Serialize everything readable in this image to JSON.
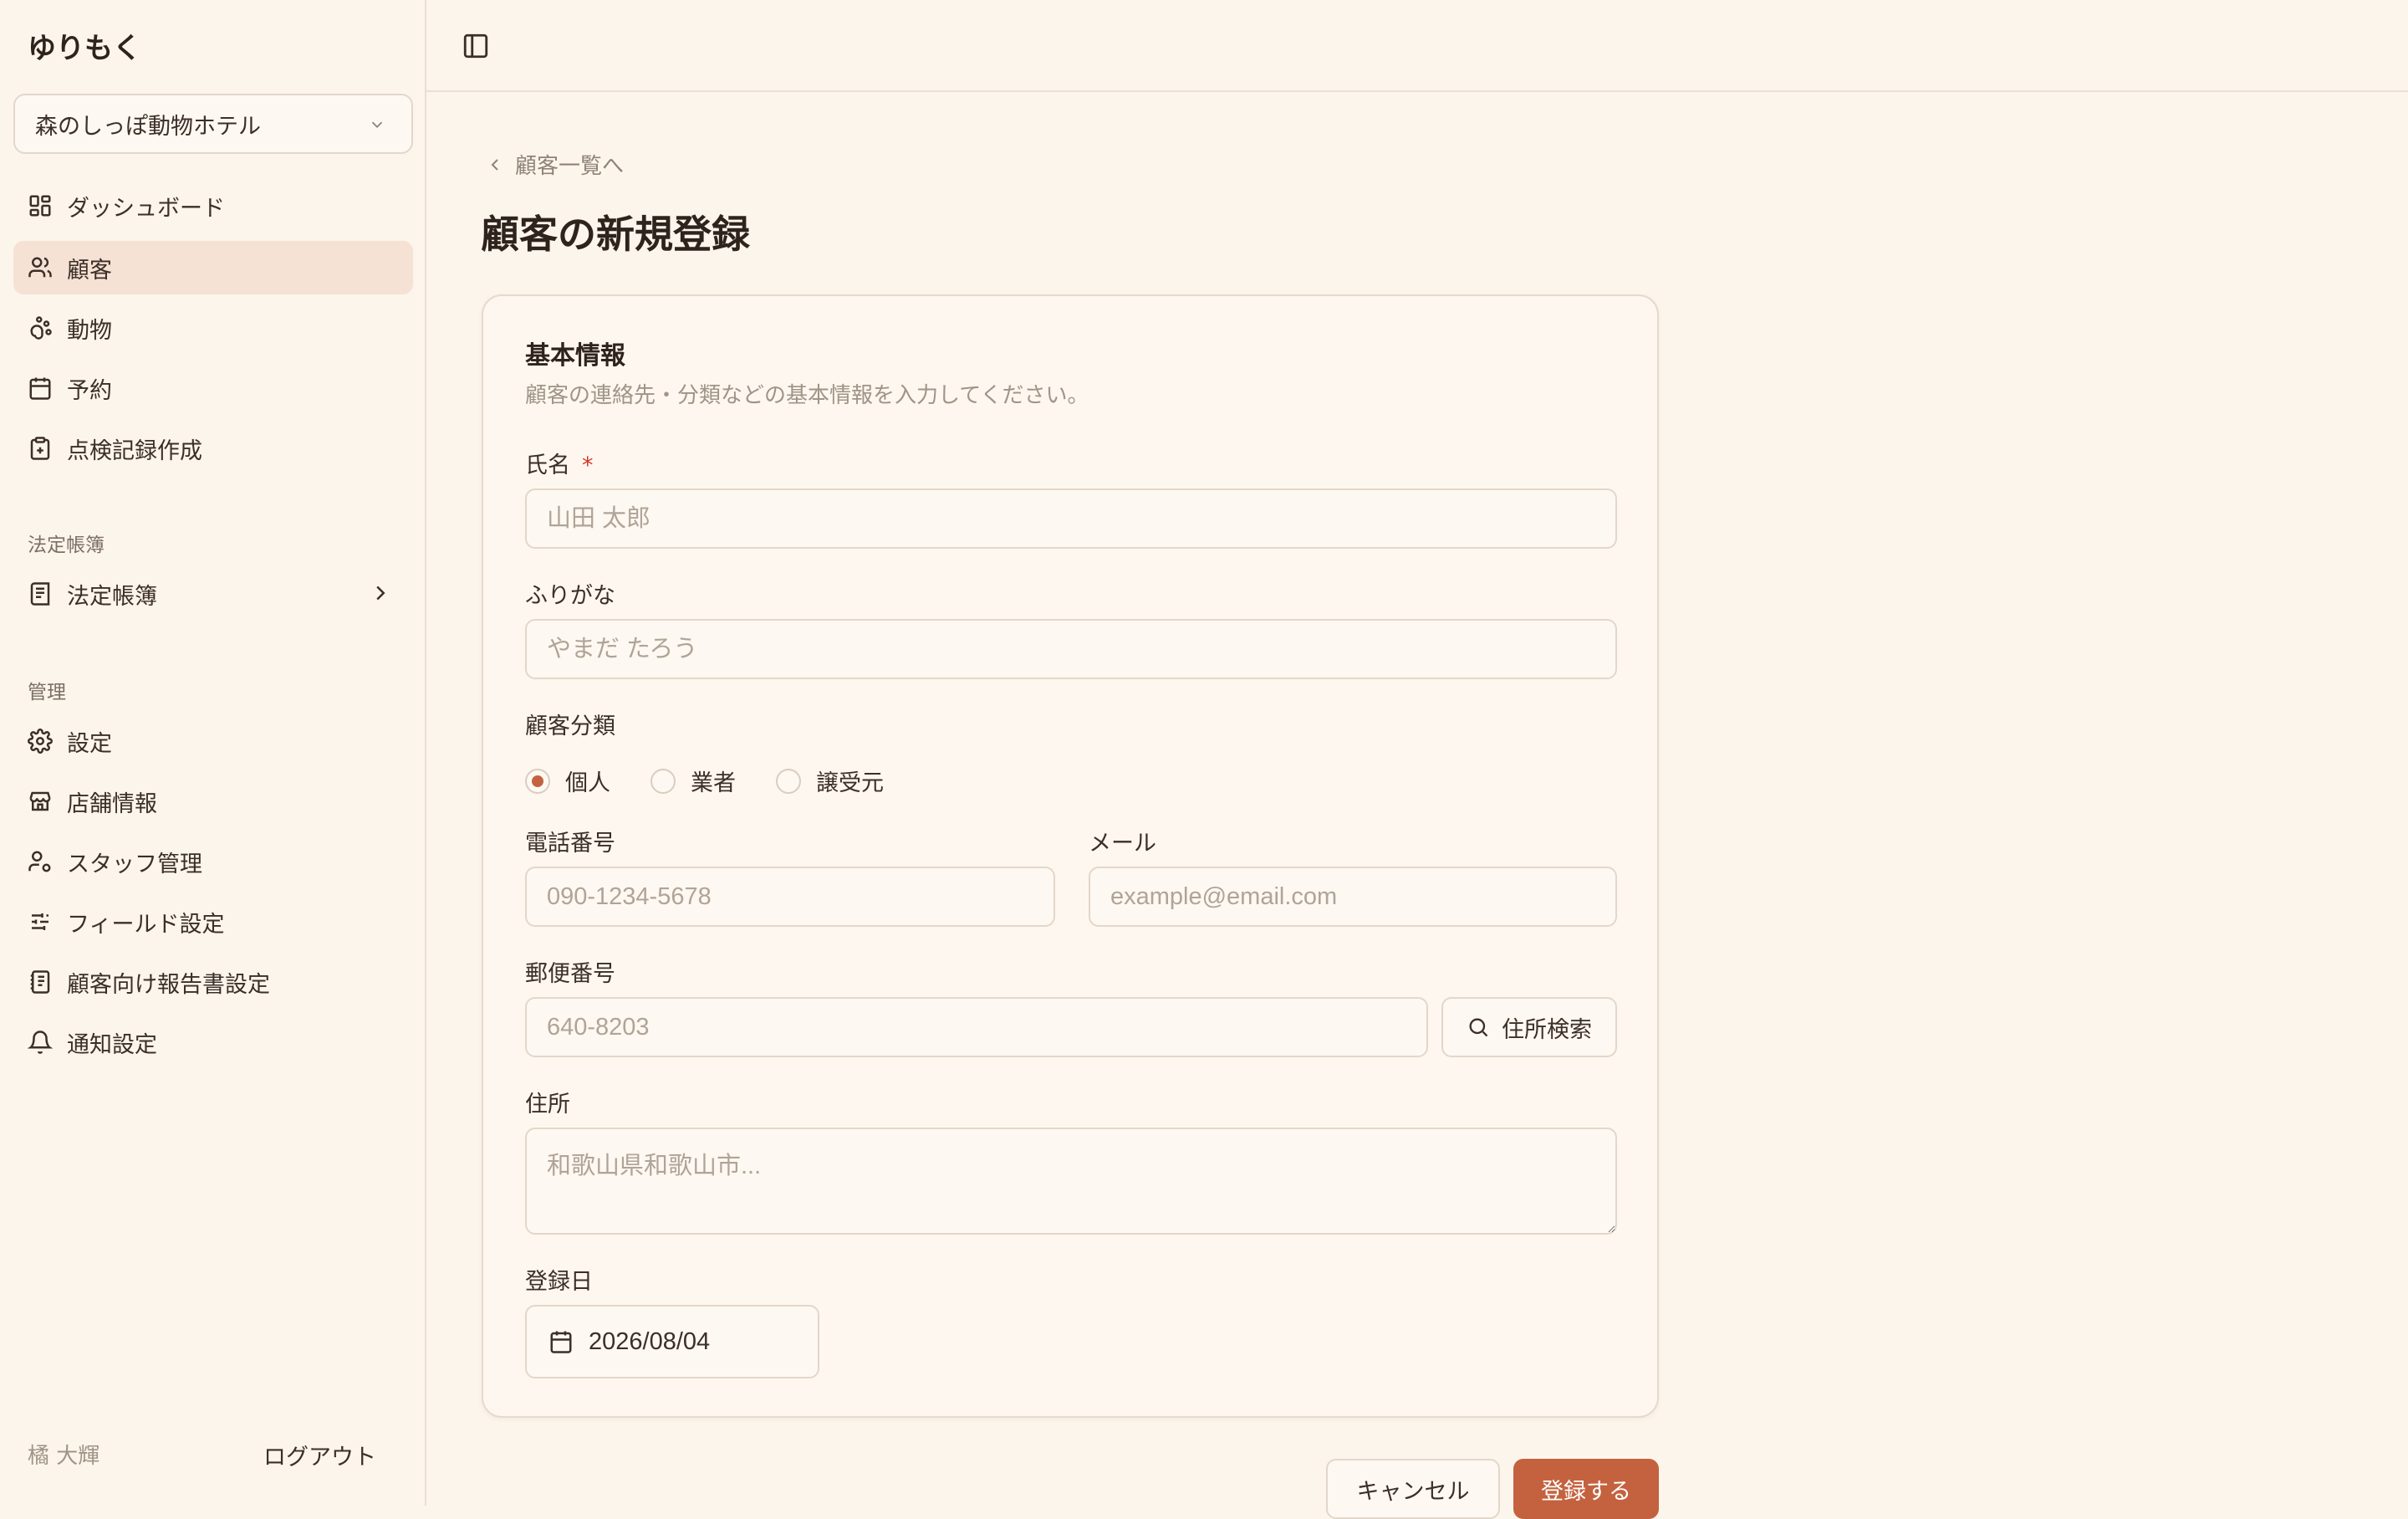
{
  "app": {
    "brand": "ゆりもく"
  },
  "sidebar": {
    "store_selector": {
      "value": "森のしっぽ動物ホテル",
      "icon": "chevron-down-icon"
    },
    "main_items": [
      {
        "label": "ダッシュボード",
        "icon": "dashboard-icon"
      },
      {
        "label": "顧客",
        "icon": "users-icon",
        "active": true
      },
      {
        "label": "動物",
        "icon": "paw-icon"
      },
      {
        "label": "予約",
        "icon": "calendar-icon"
      },
      {
        "label": "点検記録作成",
        "icon": "clipboard-plus-icon"
      }
    ],
    "ledger_section": {
      "label": "法定帳簿",
      "item": {
        "label": "法定帳簿",
        "icon": "book-icon"
      }
    },
    "admin_section": {
      "label": "管理",
      "items": [
        {
          "label": "設定",
          "icon": "gear-icon"
        },
        {
          "label": "店舗情報",
          "icon": "store-icon"
        },
        {
          "label": "スタッフ管理",
          "icon": "user-cog-icon"
        },
        {
          "label": "フィールド設定",
          "icon": "sliders-icon"
        },
        {
          "label": "顧客向け報告書設定",
          "icon": "report-icon"
        },
        {
          "label": "通知設定",
          "icon": "bell-icon"
        }
      ]
    },
    "footer": {
      "user_name": "橘 大輝",
      "logout_label": "ログアウト"
    }
  },
  "header": {
    "toggle_icon": "sidebar-toggle-icon"
  },
  "page": {
    "back_link": "顧客一覧へ",
    "title": "顧客の新規登録"
  },
  "form": {
    "section_title": "基本情報",
    "section_desc": "顧客の連絡先・分類などの基本情報を入力してください。",
    "name": {
      "label": "氏名",
      "required_mark": "*",
      "placeholder": "山田 太郎",
      "value": ""
    },
    "furigana": {
      "label": "ふりがな",
      "placeholder": "やまだ たろう",
      "value": ""
    },
    "category": {
      "label": "顧客分類",
      "options": [
        "個人",
        "業者",
        "譲受元"
      ],
      "selected": "個人"
    },
    "phone": {
      "label": "電話番号",
      "placeholder": "090-1234-5678",
      "value": ""
    },
    "email": {
      "label": "メール",
      "placeholder": "example@email.com",
      "value": ""
    },
    "postal": {
      "label": "郵便番号",
      "placeholder": "640-8203",
      "value": "",
      "search_button": "住所検索"
    },
    "address": {
      "label": "住所",
      "placeholder": "和歌山県和歌山市...",
      "value": ""
    },
    "registered_date": {
      "label": "登録日",
      "value": "2026/08/04"
    }
  },
  "actions": {
    "cancel": "キャンセル",
    "submit": "登録する"
  },
  "colors": {
    "accent": "#c4623f",
    "background": "#fcf5ec",
    "active_nav": "#f5e2d4",
    "required": "#d13a2a"
  }
}
